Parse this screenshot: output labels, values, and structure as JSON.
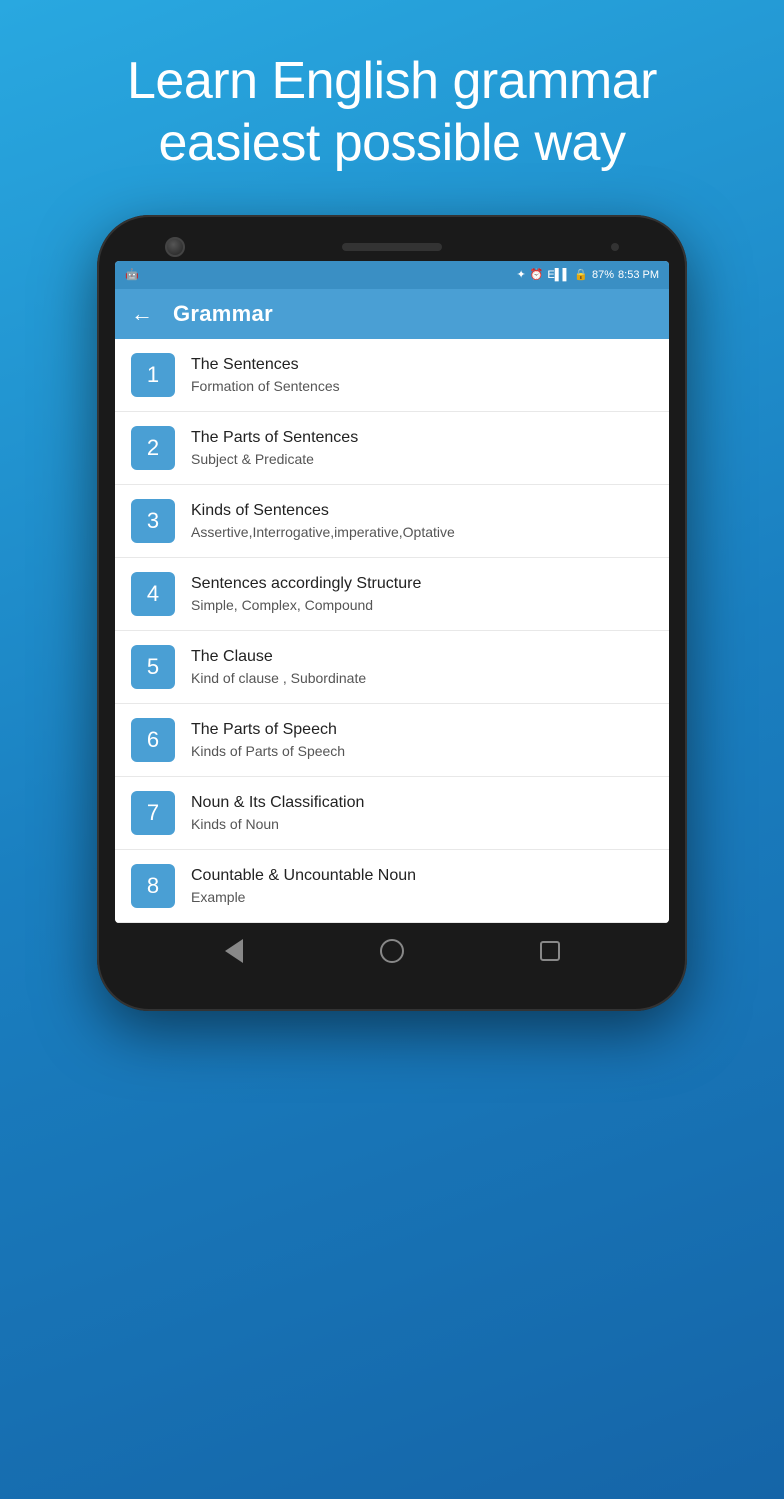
{
  "hero": {
    "line1": "Learn English grammar",
    "line2": "easiest possible way"
  },
  "status_bar": {
    "battery": "87%",
    "time": "8:53 PM"
  },
  "header": {
    "title": "Grammar",
    "back_label": "←"
  },
  "list_items": [
    {
      "number": "1",
      "title": "The Sentences",
      "subtitle": "Formation of Sentences"
    },
    {
      "number": "2",
      "title": "The Parts of Sentences",
      "subtitle": "Subject & Predicate"
    },
    {
      "number": "3",
      "title": "Kinds of Sentences",
      "subtitle": "Assertive,Interrogative,imperative,Optative"
    },
    {
      "number": "4",
      "title": "Sentences accordingly Structure",
      "subtitle": "Simple, Complex, Compound"
    },
    {
      "number": "5",
      "title": "The Clause",
      "subtitle": "Kind of clause , Subordinate"
    },
    {
      "number": "6",
      "title": "The Parts of Speech",
      "subtitle": "Kinds of Parts of Speech"
    },
    {
      "number": "7",
      "title": "Noun & Its Classification",
      "subtitle": "Kinds of Noun"
    },
    {
      "number": "8",
      "title": "Countable & Uncountable Noun",
      "subtitle": "Example"
    }
  ]
}
